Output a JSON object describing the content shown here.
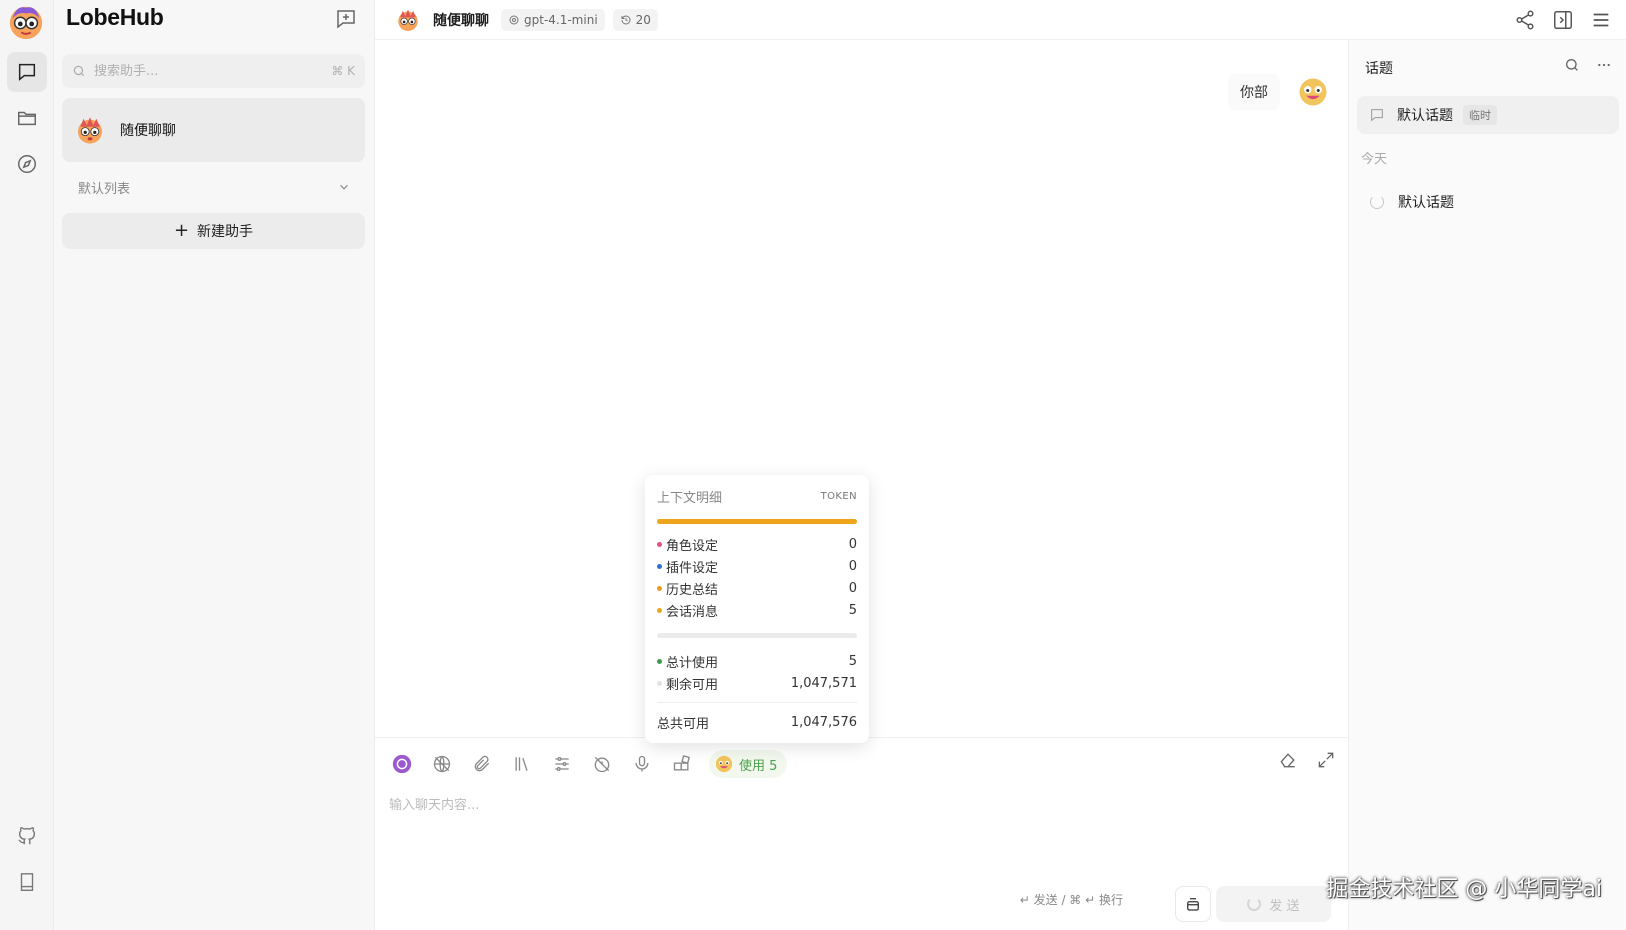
{
  "brand": {
    "name": "LobeHub"
  },
  "search": {
    "placeholder": "搜索助手...",
    "shortcut": "⌘ K"
  },
  "sessions": {
    "items": [
      {
        "name": "随便聊聊"
      }
    ],
    "group_label": "默认列表",
    "new_assistant_label": "新建助手"
  },
  "header": {
    "title": "随便聊聊",
    "model": "gpt-4.1-mini",
    "history_count": "20"
  },
  "chat": {
    "messages": [
      {
        "role": "user",
        "text": "你部"
      }
    ]
  },
  "composer": {
    "usage_label": "使用 5",
    "placeholder": "输入聊天内容...",
    "send_hint": "↵ 发送 / ⌘ ↵ 换行",
    "send_label": "发 送"
  },
  "token_popover": {
    "title": "上下文明细",
    "unit": "TOKEN",
    "rows": [
      {
        "label": "角色设定",
        "value": "0",
        "color": "#e0508a"
      },
      {
        "label": "插件设定",
        "value": "0",
        "color": "#2f6fe0"
      },
      {
        "label": "历史总结",
        "value": "0",
        "color": "#ef9a1b"
      },
      {
        "label": "会话消息",
        "value": "5",
        "color": "#e7a817"
      }
    ],
    "usage_rows": [
      {
        "label": "总计使用",
        "value": "5",
        "color": "#3c9a4a"
      },
      {
        "label": "剩余可用",
        "value": "1,047,571",
        "color": "#e2e2e2"
      }
    ],
    "total_label": "总共可用",
    "total_value": "1,047,576"
  },
  "topics": {
    "title": "话题",
    "active": {
      "label": "默认话题",
      "badge": "临时"
    },
    "date_group": "今天",
    "items": [
      {
        "label": "默认话题"
      }
    ]
  },
  "watermark": "掘金技术社区 @ 小华同学ai",
  "colors": {
    "accent": "#eea41b",
    "usage_green": "#4aa14a"
  }
}
